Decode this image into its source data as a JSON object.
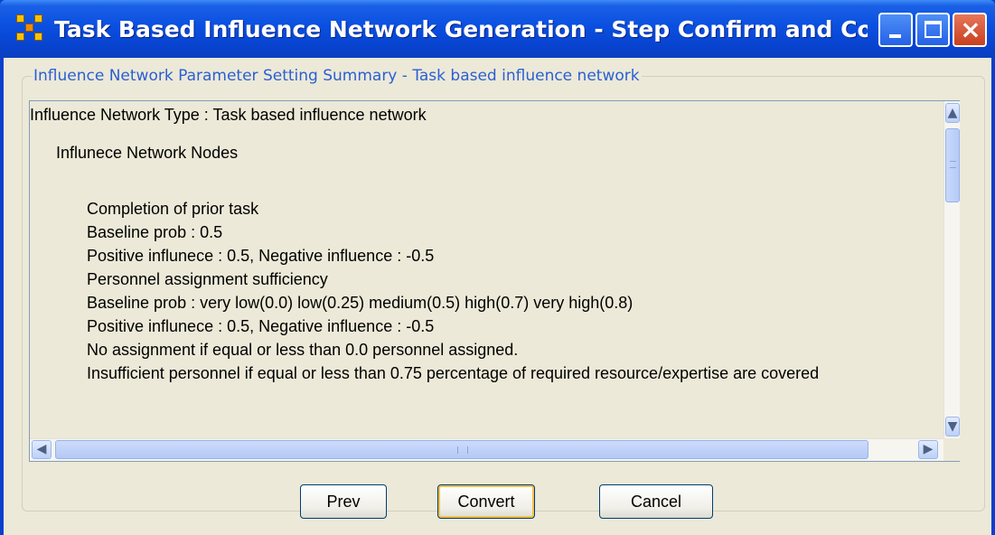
{
  "window": {
    "title": "Task Based Influence Network Generation - Step Confirm and Convert ...",
    "minimize_label": "",
    "maximize_label": "",
    "close_label": "×"
  },
  "group": {
    "legend": "Influence Network Parameter Setting Summary - Task based influence network"
  },
  "summary": {
    "lines": [
      "Influence Network Type : Task based influence network",
      "",
      "Influnece Network Nodes",
      "",
      "Completion of prior task",
      "Baseline prob : 0.5",
      "Positive influnece : 0.5, Negative influence : -0.5",
      "Personnel assignment sufficiency",
      "Baseline prob : very low(0.0)  low(0.25)  medium(0.5)  high(0.7)  very high(0.8)",
      "Positive influnece : 0.5, Negative influence : -0.5",
      "No assignment if equal or less than 0.0 personnel assigned.",
      "Insufficient personnel if equal or less than 0.75 percentage of required resource/expertise are covered"
    ]
  },
  "scroll": {
    "up_glyph": "▲",
    "down_glyph": "▼",
    "left_glyph": "◀",
    "right_glyph": "▶"
  },
  "buttons": {
    "prev": "Prev",
    "convert": "Convert",
    "cancel": "Cancel"
  },
  "colors": {
    "title_bar": "#0a4fe0",
    "legend_text": "#2b5fd3",
    "dialog_background": "#ece9d8",
    "close_button": "#c8401f"
  }
}
